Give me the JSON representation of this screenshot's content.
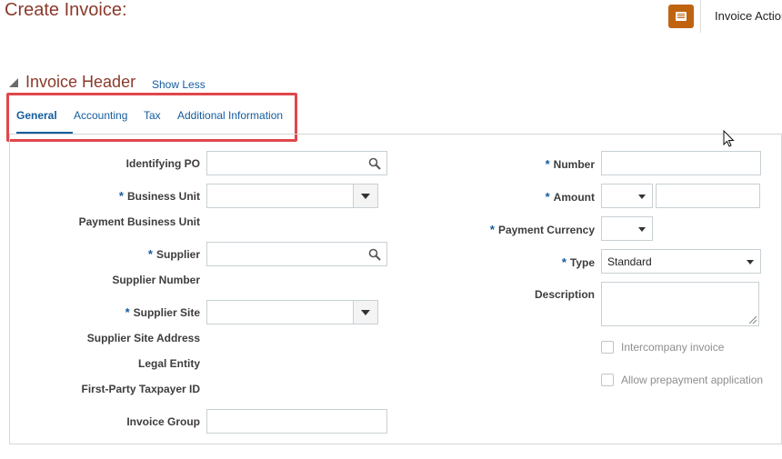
{
  "page": {
    "title": "Create Invoice:",
    "actions_label": "Invoice Actions"
  },
  "section": {
    "title": "Invoice Header",
    "show_less": "Show Less"
  },
  "tabs": [
    {
      "label": "General",
      "active": true
    },
    {
      "label": "Accounting",
      "active": false
    },
    {
      "label": "Tax",
      "active": false
    },
    {
      "label": "Additional Information",
      "active": false
    }
  ],
  "left_fields": {
    "identifying_po": {
      "label": "Identifying PO",
      "value": ""
    },
    "business_unit": {
      "label": "Business Unit",
      "required": true,
      "value": ""
    },
    "payment_business_unit": {
      "label": "Payment Business Unit"
    },
    "supplier": {
      "label": "Supplier",
      "required": true,
      "value": ""
    },
    "supplier_number": {
      "label": "Supplier Number"
    },
    "supplier_site": {
      "label": "Supplier Site",
      "required": true,
      "value": ""
    },
    "supplier_site_address": {
      "label": "Supplier Site Address"
    },
    "legal_entity": {
      "label": "Legal Entity"
    },
    "first_party_taxpayer_id": {
      "label": "First-Party Taxpayer ID"
    },
    "invoice_group": {
      "label": "Invoice Group",
      "value": ""
    }
  },
  "right_fields": {
    "number": {
      "label": "Number",
      "required": true,
      "value": ""
    },
    "amount": {
      "label": "Amount",
      "required": true,
      "currency": "",
      "value": ""
    },
    "payment_currency": {
      "label": "Payment Currency",
      "required": true,
      "value": ""
    },
    "type": {
      "label": "Type",
      "required": true,
      "value": "Standard"
    },
    "description": {
      "label": "Description",
      "value": ""
    },
    "intercompany_invoice": {
      "label": "Intercompany invoice",
      "checked": false
    },
    "allow_prepayment_application": {
      "label": "Allow prepayment application",
      "checked": false
    }
  },
  "colors": {
    "title": "#8b3a2b",
    "link": "#145c9e",
    "accent_button": "#c0630f",
    "highlight_box": "#e0474c"
  },
  "icons": {
    "search": "search-icon",
    "dropdown": "chevron-down-icon",
    "actions": "document-icon"
  }
}
